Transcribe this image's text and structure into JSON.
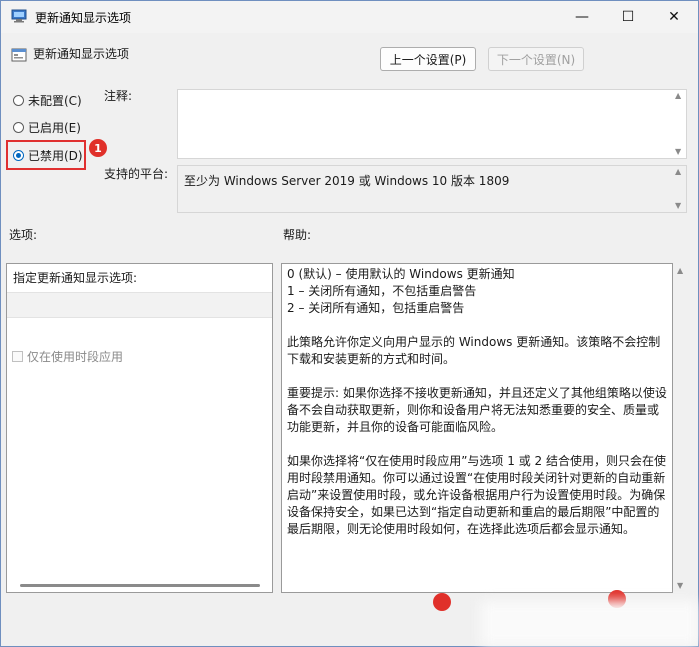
{
  "window": {
    "title": "更新通知显示选项",
    "minimize_glyph": "—",
    "maximize_glyph": "☐",
    "close_glyph": "✕"
  },
  "header": {
    "policy_name": "更新通知显示选项",
    "prev_button": "上一个设置(P)",
    "next_button": "下一个设置(N)"
  },
  "state": {
    "options": [
      {
        "label": "未配置(C)",
        "checked": false
      },
      {
        "label": "已启用(E)",
        "checked": false
      },
      {
        "label": "已禁用(D)",
        "checked": true
      }
    ],
    "badge_1": "1"
  },
  "comment": {
    "label": "注释:",
    "value": ""
  },
  "platform": {
    "label": "支持的平台:",
    "value": "至少为 Windows Server 2019 或 Windows 10 版本 1809"
  },
  "options_section": {
    "label": "选项:",
    "heading": "指定更新通知显示选项:",
    "checkbox_label": "仅在使用时段应用"
  },
  "help_section": {
    "label": "帮助:",
    "text": {
      "l1": "0 (默认) – 使用默认的 Windows 更新通知",
      "l2": "1 – 关闭所有通知，不包括重启警告",
      "l3": "2 – 关闭所有通知，包括重启警告",
      "p2": "此策略允许你定义向用户显示的 Windows 更新通知。该策略不会控制下载和安装更新的方式和时间。",
      "p3": "重要提示: 如果你选择不接收更新通知，并且还定义了其他组策略以使设备不会自动获取更新，则你和设备用户将无法知悉重要的安全、质量或功能更新，并且你的设备可能面临风险。",
      "p4": "如果你选择将“仅在使用时段应用”与选项 1 或 2 结合使用，则只会在使用时段禁用通知。你可以通过设置“在使用时段关闭针对更新的自动重新启动”来设置使用时段，或允许设备根据用户行为设置使用时段。为确保设备保持安全，如果已达到“指定自动更新和重启的最后期限”中配置的最后期限，则无论使用时段如何，在选择此选项后都会显示通知。"
    }
  },
  "colors": {
    "accent": "#0067c0",
    "highlight": "#e03030",
    "badge": "#e0302a"
  }
}
